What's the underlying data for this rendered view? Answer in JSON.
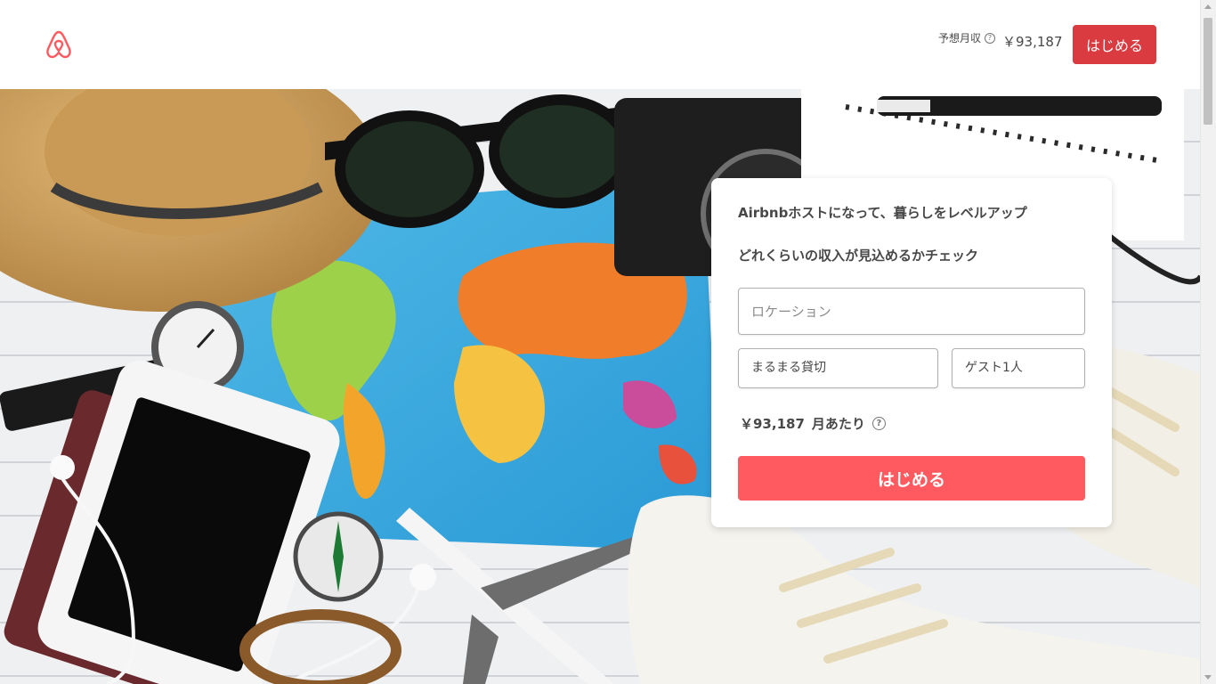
{
  "header": {
    "earnings_label": "予想月収",
    "earnings_value": "￥93,187",
    "start_button": "はじめる"
  },
  "card": {
    "title": "Airbnbホストになって、暮らしをレベルアップ",
    "subtitle": "どれくらいの収入が見込めるかチェック",
    "location_placeholder": "ロケーション",
    "room_type": "まるまる貸切",
    "guests": "ゲスト1人",
    "estimate_amount": "￥93,187",
    "estimate_period": "月あたり",
    "start_button": "はじめる"
  },
  "colors": {
    "brand": "#ff5a5f",
    "header_button": "#d93b41"
  },
  "icons": {
    "logo": "airbnb-logo-icon",
    "help": "question-circle-icon"
  }
}
